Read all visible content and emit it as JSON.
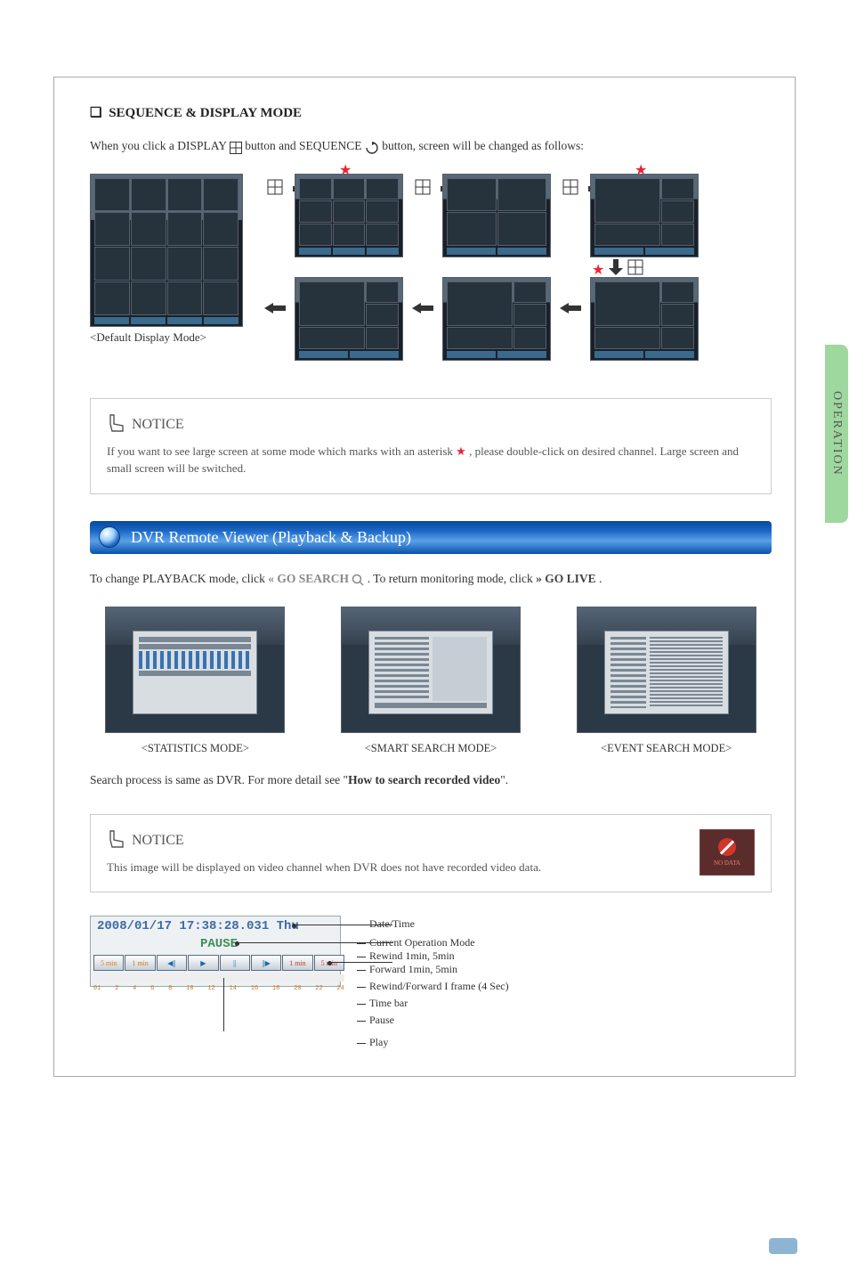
{
  "sideTab": "OPERATION",
  "sectionTitle": "SEQUENCE & DISPLAY MODE",
  "intro_pre": "When you click a DISPLAY ",
  "intro_mid": " button and SEQUENCE ",
  "intro_post": " button, screen will be changed as follows:",
  "defaultCaption": "<Default Display Mode>",
  "notice1": {
    "title": "NOTICE",
    "text_pre": "If you want to see large screen at some mode which marks with an asterisk ",
    "text_post": " , please double-click on desired channel. Large screen and small screen will be switched."
  },
  "blueHeader": "DVR Remote Viewer (Playback & Backup)",
  "playbackIntro": {
    "pre": "To change PLAYBACK mode, click ",
    "gosearch": "GO SEARCH",
    "mid": ".  To return monitoring mode, click ",
    "golive": "GO LIVE",
    "post": "."
  },
  "modeLabels": {
    "stats": "<STATISTICS MODE>",
    "smart": "<SMART SEARCH MODE>",
    "event": "<EVENT SEARCH MODE>"
  },
  "searchLine_pre": "Search process is same as DVR. For more detail see \"",
  "searchLine_bold": "How to search recorded video",
  "searchLine_post": "\".",
  "notice2": {
    "title": "NOTICE",
    "text": "This image will be displayed on video channel when DVR does not have recorded video data.",
    "nodata": "NO DATA"
  },
  "playback": {
    "datetime": "2008/01/17 17:38:28.031 Thu",
    "pause": "PAUSE",
    "buttons": [
      "5 min",
      "1 min",
      "◀||",
      "▶",
      "||",
      "||▶",
      "1 min",
      "5 min"
    ],
    "ticks": [
      "01",
      "2",
      "4",
      "6",
      "8",
      "10",
      "12",
      "14",
      "16",
      "18",
      "20",
      "22",
      "24"
    ]
  },
  "callouts": {
    "dateTime": "Date/Time",
    "mode": "Current Operation Mode",
    "rewind": "Rewind 1min, 5min",
    "forward": "Forward 1min, 5min",
    "rwFwd": "Rewind/Forward I frame (4 Sec)",
    "timebar": "Time bar",
    "pause": "Pause",
    "play": "Play"
  }
}
